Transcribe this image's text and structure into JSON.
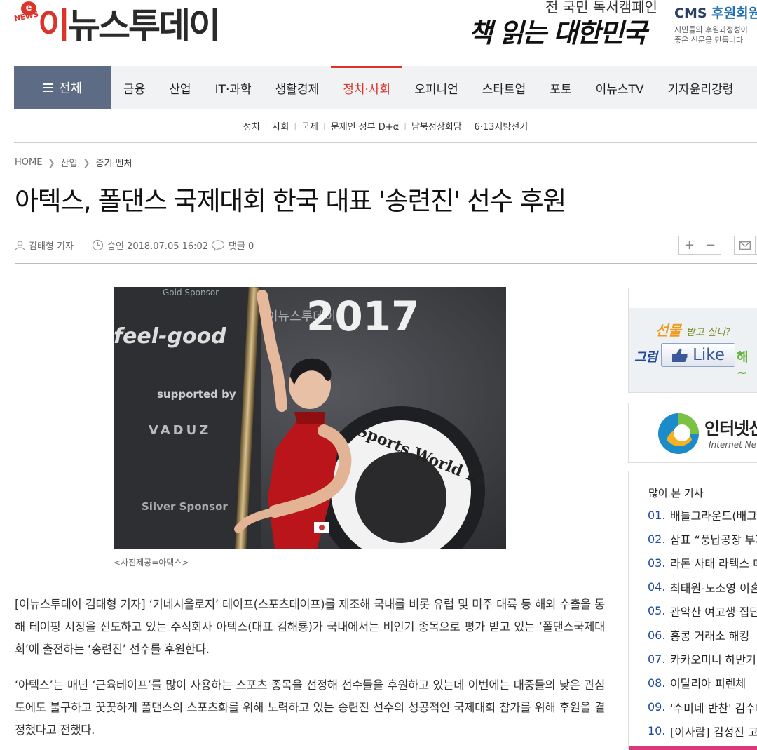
{
  "header": {
    "logo_badge": "e",
    "logo_news": "NEWS",
    "logo_first": "이",
    "logo_rest": "뉴스투데이",
    "campaign_top": "전 국민 독서캠페인",
    "campaign_main": "책 읽는 대한민국",
    "cms_label": "CMS",
    "cms_link": "후원회원",
    "cms_desc_1": "시민들의 후원과정성이",
    "cms_desc_2": "좋은 신문을 만듭니다"
  },
  "nav": {
    "all_label": "전체",
    "items": [
      {
        "label": "금융"
      },
      {
        "label": "산업"
      },
      {
        "label": "IT·과학"
      },
      {
        "label": "생활경제"
      },
      {
        "label": "정치·사회"
      },
      {
        "label": "오피니언"
      },
      {
        "label": "스타트업"
      },
      {
        "label": "포토"
      },
      {
        "label": "이뉴스TV"
      },
      {
        "label": "기자윤리강령"
      }
    ],
    "active_index": 4,
    "accent_color": "#d9352b",
    "all_bg_color": "#5d6b84"
  },
  "subnav": {
    "items": [
      {
        "label": "정치"
      },
      {
        "label": "사회"
      },
      {
        "label": "국제"
      },
      {
        "label": "문재인 정부 D+α"
      },
      {
        "label": "남북정상회담"
      },
      {
        "label": "6·13지방선거"
      }
    ]
  },
  "breadcrumb": {
    "home": "HOME",
    "level1": "산업",
    "level2": "중기·벤처"
  },
  "article": {
    "title": "아텍스, 폴댄스 국제대회 한국 대표 '송련진' 선수 후원",
    "author": "김태형 기자",
    "approved": "승인 2018.07.05 16:02",
    "comments": "댓글 0",
    "photo_text_year": "2017",
    "photo_text_watermark": "이뉴스투데이",
    "photo_text_feelgood": "feel-good",
    "photo_text_supported": "supported by",
    "photo_text_vaduz": "VADUZ",
    "photo_text_silver": "Silver Sponsor",
    "photo_text_gold": "Gold Sponsor",
    "photo_text_sports": "Sports World Fe",
    "photo_caption": "<사진제공=아텍스>",
    "paragraphs": [
      "[이뉴스투데이 김태형 기자] ‘키네시올로지’ 테이프(스포츠테이프)를 제조해 국내를 비롯 유럽 및 미주 대륙 등 해외 수출을 통해 테이핑 시장을 선도하고 있는 주식회사 아텍스(대표 김해룡)가 국내에서는 비인기 종목으로 평가 받고 있는 ‘폴댄스국제대회’에 출전하는 ‘송련진’ 선수를 후원한다.",
      "‘아텍스’는 매년 ‘근육테이프’를 많이 사용하는 스포츠 종목을 선정해 선수들을 후원하고 있는데 이번에는 대중들의 낮은 관심도에도 불구하고 꿋꿋하게 폴댄스의 스포츠화를 위해 노력하고 있는 송련진 선수의 성공적인 국제대회 참가를 위해 후원을 결정했다고 전했다."
    ]
  },
  "sidebar": {
    "like_question": "선물",
    "like_question_small": "받고 싶니?",
    "like_then": "그럼",
    "like_button": "Like",
    "like_after": "해~",
    "internet_name": "인터넷신문위원회",
    "internet_sub": "Internet News Commission",
    "popular_title": "많이 본 기사",
    "popular": [
      {
        "num": "01.",
        "title": "배틀그라운드(배그)"
      },
      {
        "num": "02.",
        "title": "삼표 “풍납공장 부지"
      },
      {
        "num": "03.",
        "title": "라돈 사태 라텍스 매"
      },
      {
        "num": "04.",
        "title": "최태원-노소영 이혼"
      },
      {
        "num": "05.",
        "title": "관악산 여고생 집단"
      },
      {
        "num": "06.",
        "title": "홍콩 거래소 해킹"
      },
      {
        "num": "07.",
        "title": "카카오미니 하반기"
      },
      {
        "num": "08.",
        "title": "이탈리아 피렌체"
      },
      {
        "num": "09.",
        "title": "'수미네 반찬' 김수미"
      },
      {
        "num": "10.",
        "title": "[이사람] 김성진 고"
      }
    ]
  }
}
